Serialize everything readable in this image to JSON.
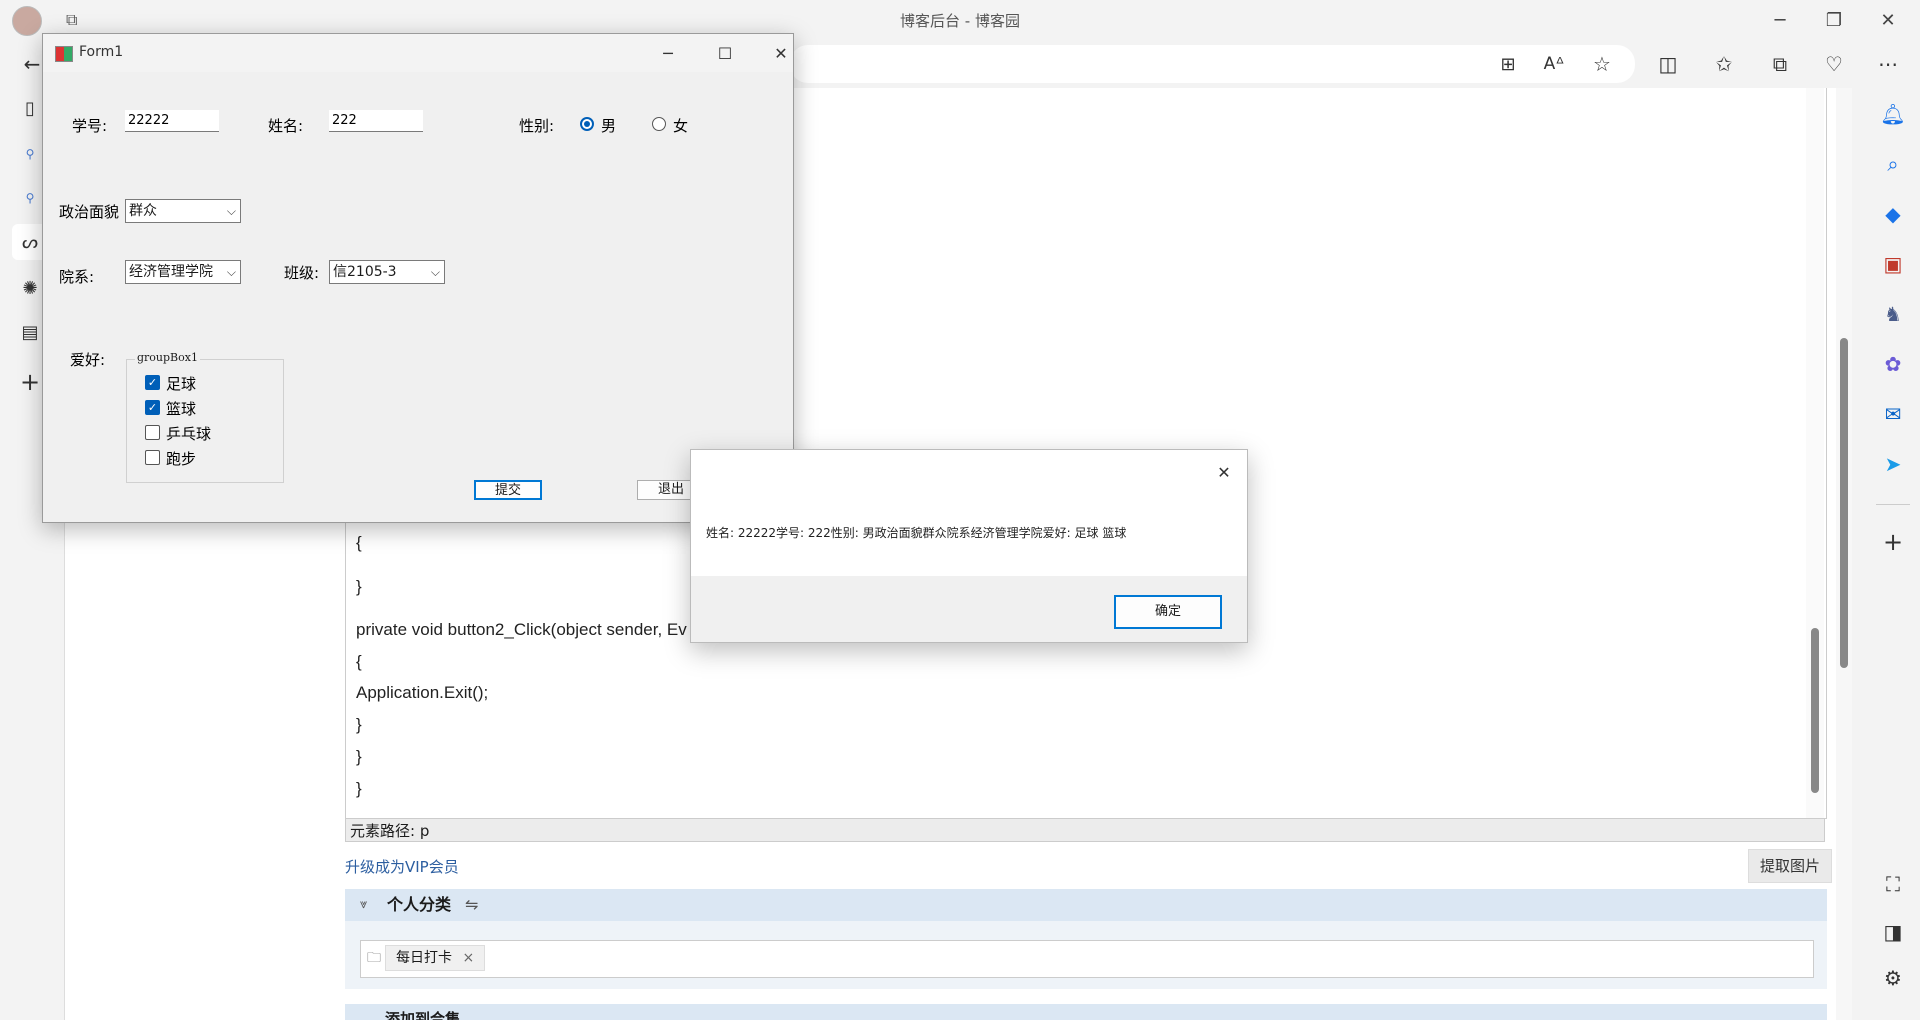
{
  "browser": {
    "title": "博客后台 - 博客园",
    "minimize_icon": "minimize-icon",
    "restore_icon": "restore-icon",
    "close_icon": "close-icon"
  },
  "editor": {
    "code_lines": [
      "{",
      "}",
      "private void button2_Click(object sender, Ev",
      "{",
      "Application.Exit();",
      "}",
      "}",
      "}"
    ],
    "status_path": "元素路径: p",
    "vip_link": "升级成为VIP会员",
    "extract_image_button": "提取图片",
    "category_header": "个人分类",
    "category_tag": "每日打卡",
    "collection_header": "添加到合集"
  },
  "form1": {
    "title": "Form1",
    "student_id_label": "学号:",
    "student_id_value": "22222",
    "name_label": "姓名:",
    "name_value": "222",
    "gender_label": "性别:",
    "gender_options": [
      "男",
      "女"
    ],
    "gender_selected": "男",
    "politics_label": "政治面貌",
    "politics_value": "群众",
    "department_label": "院系:",
    "department_value": "经济管理学院",
    "class_label": "班级:",
    "class_value": "信2105-3",
    "hobby_label": "爱好:",
    "groupbox_title": "groupBox1",
    "hobbies": [
      {
        "label": "足球",
        "checked": true
      },
      {
        "label": "篮球",
        "checked": true
      },
      {
        "label": "乒乓球",
        "checked": false
      },
      {
        "label": "跑步",
        "checked": false
      }
    ],
    "submit_button": "提交",
    "exit_button": "退出"
  },
  "message_box": {
    "text": "姓名: 22222学号: 222性别: 男政治面貌群众院系经济管理学院爱好:  足球 篮球",
    "ok_button": "确定"
  },
  "colors": {
    "accent": "#005fb8",
    "link": "#2c5ea0",
    "category_bar": "#dbe7f3"
  }
}
